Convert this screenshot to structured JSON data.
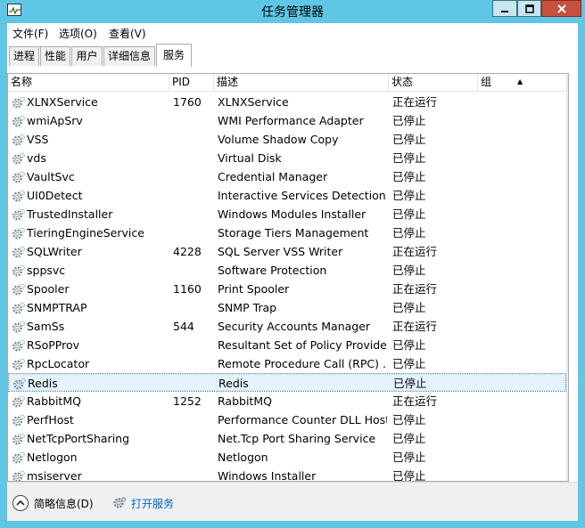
{
  "window": {
    "title": "任务管理器"
  },
  "menu": [
    {
      "label": "文件(F)"
    },
    {
      "label": "选项(O)"
    },
    {
      "label": "查看(V)"
    }
  ],
  "tabs": [
    {
      "label": "进程"
    },
    {
      "label": "性能"
    },
    {
      "label": "用户"
    },
    {
      "label": "详细信息"
    },
    {
      "label": "服务",
      "active": true
    }
  ],
  "columns": {
    "name": "名称",
    "pid": "PID",
    "desc": "描述",
    "status": "状态",
    "group": "组"
  },
  "services": [
    {
      "name": "XLNXService",
      "pid": "1760",
      "desc": "XLNXService",
      "status": "正在运行"
    },
    {
      "name": "wmiApSrv",
      "pid": "",
      "desc": "WMI Performance Adapter",
      "status": "已停止"
    },
    {
      "name": "VSS",
      "pid": "",
      "desc": "Volume Shadow Copy",
      "status": "已停止"
    },
    {
      "name": "vds",
      "pid": "",
      "desc": "Virtual Disk",
      "status": "已停止"
    },
    {
      "name": "VaultSvc",
      "pid": "",
      "desc": "Credential Manager",
      "status": "已停止"
    },
    {
      "name": "UI0Detect",
      "pid": "",
      "desc": "Interactive Services Detection",
      "status": "已停止"
    },
    {
      "name": "TrustedInstaller",
      "pid": "",
      "desc": "Windows Modules Installer",
      "status": "已停止"
    },
    {
      "name": "TieringEngineService",
      "pid": "",
      "desc": "Storage Tiers Management",
      "status": "已停止"
    },
    {
      "name": "SQLWriter",
      "pid": "4228",
      "desc": "SQL Server VSS Writer",
      "status": "正在运行"
    },
    {
      "name": "sppsvc",
      "pid": "",
      "desc": "Software Protection",
      "status": "已停止"
    },
    {
      "name": "Spooler",
      "pid": "1160",
      "desc": "Print Spooler",
      "status": "正在运行"
    },
    {
      "name": "SNMPTRAP",
      "pid": "",
      "desc": "SNMP Trap",
      "status": "已停止"
    },
    {
      "name": "SamSs",
      "pid": "544",
      "desc": "Security Accounts Manager",
      "status": "正在运行"
    },
    {
      "name": "RSoPProv",
      "pid": "",
      "desc": "Resultant Set of Policy Provider",
      "status": "已停止"
    },
    {
      "name": "RpcLocator",
      "pid": "",
      "desc": "Remote Procedure Call (RPC) ...",
      "status": "已停止"
    },
    {
      "name": "Redis",
      "pid": "",
      "desc": "Redis",
      "status": "已停止",
      "selected": true
    },
    {
      "name": "RabbitMQ",
      "pid": "1252",
      "desc": "RabbitMQ",
      "status": "正在运行"
    },
    {
      "name": "PerfHost",
      "pid": "",
      "desc": "Performance Counter DLL Host",
      "status": "已停止"
    },
    {
      "name": "NetTcpPortSharing",
      "pid": "",
      "desc": "Net.Tcp Port Sharing Service",
      "status": "已停止"
    },
    {
      "name": "Netlogon",
      "pid": "",
      "desc": "Netlogon",
      "status": "已停止"
    },
    {
      "name": "msiserver",
      "pid": "",
      "desc": "Windows Installer",
      "status": "已停止"
    }
  ],
  "footer": {
    "fewer_details": "简略信息(D)",
    "open_services": "打开服务"
  },
  "colors": {
    "frame": "#5fc6e6",
    "close_button": "#c7503f",
    "link": "#0066cc",
    "selected_row": "#e5f3fb"
  }
}
